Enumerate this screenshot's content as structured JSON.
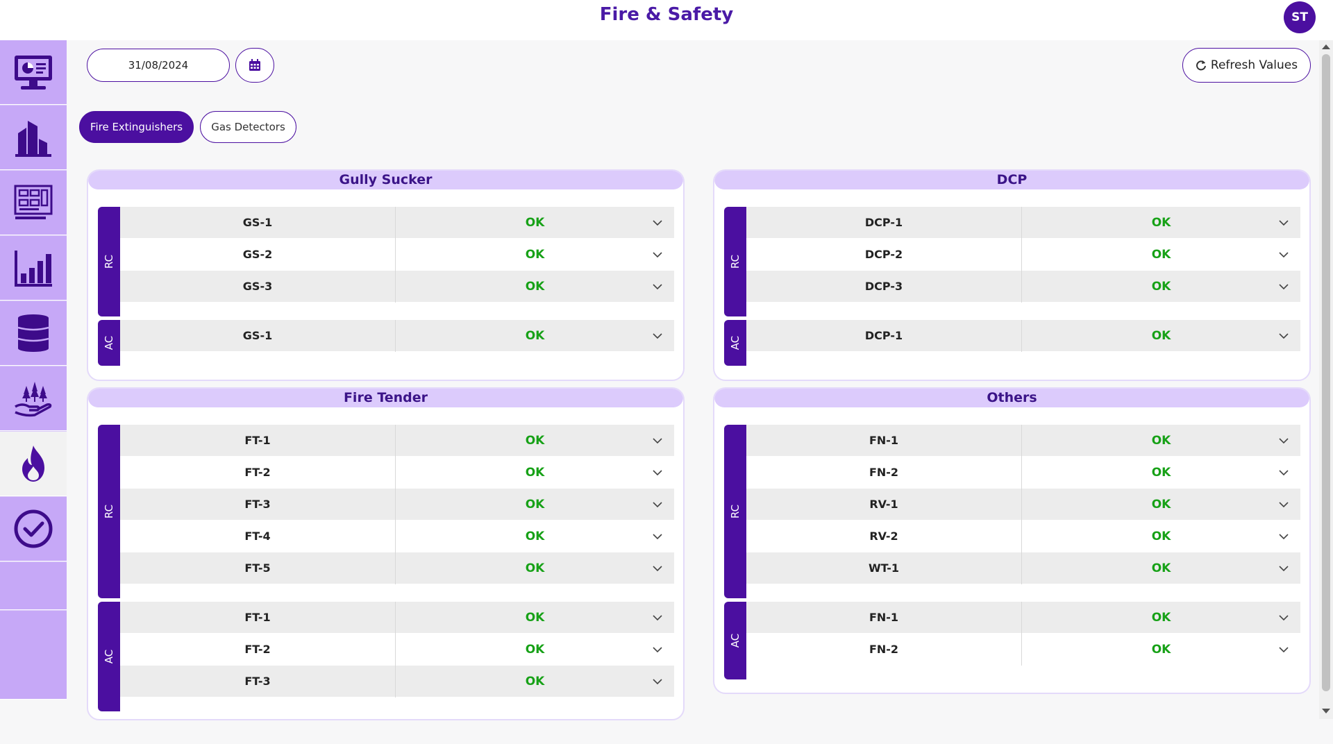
{
  "header": {
    "title": "Fire & Safety",
    "avatar_initials": "ST"
  },
  "sidebar": {
    "items": [
      {
        "icon": "dashboard-monitor-icon",
        "active": false
      },
      {
        "icon": "buildings-icon",
        "active": false
      },
      {
        "icon": "control-panel-icon",
        "active": false
      },
      {
        "icon": "bar-chart-icon",
        "active": false
      },
      {
        "icon": "oil-barrel-icon",
        "active": false
      },
      {
        "icon": "environment-hand-icon",
        "active": false
      },
      {
        "icon": "fire-icon",
        "active": true
      },
      {
        "icon": "check-circle-icon",
        "active": false
      }
    ]
  },
  "toolbar": {
    "date_value": "31/08/2024",
    "calendar_icon": "calendar-icon",
    "refresh_label": "Refresh Values",
    "refresh_icon": "refresh-icon"
  },
  "tabs": [
    {
      "label": "Fire Extinguishers",
      "active": true
    },
    {
      "label": "Gas Detectors",
      "active": false
    }
  ],
  "colors": {
    "accent": "#4b0fa0",
    "panel_header": "#dccbfc",
    "status_ok": "#17a117",
    "sidebar": "#c6a8f7"
  },
  "panels": {
    "gully_sucker": {
      "title": "Gully Sucker",
      "groups": [
        {
          "tag": "RC",
          "rows": [
            {
              "id": "GS-1",
              "status": "OK"
            },
            {
              "id": "GS-2",
              "status": "OK"
            },
            {
              "id": "GS-3",
              "status": "OK"
            }
          ]
        },
        {
          "tag": "AC",
          "rows": [
            {
              "id": "GS-1",
              "status": "OK"
            }
          ]
        }
      ]
    },
    "dcp": {
      "title": "DCP",
      "groups": [
        {
          "tag": "RC",
          "rows": [
            {
              "id": "DCP-1",
              "status": "OK"
            },
            {
              "id": "DCP-2",
              "status": "OK"
            },
            {
              "id": "DCP-3",
              "status": "OK"
            }
          ]
        },
        {
          "tag": "AC",
          "rows": [
            {
              "id": "DCP-1",
              "status": "OK"
            }
          ]
        }
      ]
    },
    "fire_tender": {
      "title": "Fire Tender",
      "groups": [
        {
          "tag": "RC",
          "rows": [
            {
              "id": "FT-1",
              "status": "OK"
            },
            {
              "id": "FT-2",
              "status": "OK"
            },
            {
              "id": "FT-3",
              "status": "OK"
            },
            {
              "id": "FT-4",
              "status": "OK"
            },
            {
              "id": "FT-5",
              "status": "OK"
            }
          ]
        },
        {
          "tag": "AC",
          "rows": [
            {
              "id": "FT-1",
              "status": "OK"
            },
            {
              "id": "FT-2",
              "status": "OK"
            },
            {
              "id": "FT-3",
              "status": "OK"
            }
          ]
        }
      ]
    },
    "others": {
      "title": "Others",
      "groups": [
        {
          "tag": "RC",
          "rows": [
            {
              "id": "FN-1",
              "status": "OK"
            },
            {
              "id": "FN-2",
              "status": "OK"
            },
            {
              "id": "RV-1",
              "status": "OK"
            },
            {
              "id": "RV-2",
              "status": "OK"
            },
            {
              "id": "WT-1",
              "status": "OK"
            }
          ]
        },
        {
          "tag": "AC",
          "rows": [
            {
              "id": "FN-1",
              "status": "OK"
            },
            {
              "id": "FN-2",
              "status": "OK"
            }
          ]
        }
      ]
    }
  }
}
